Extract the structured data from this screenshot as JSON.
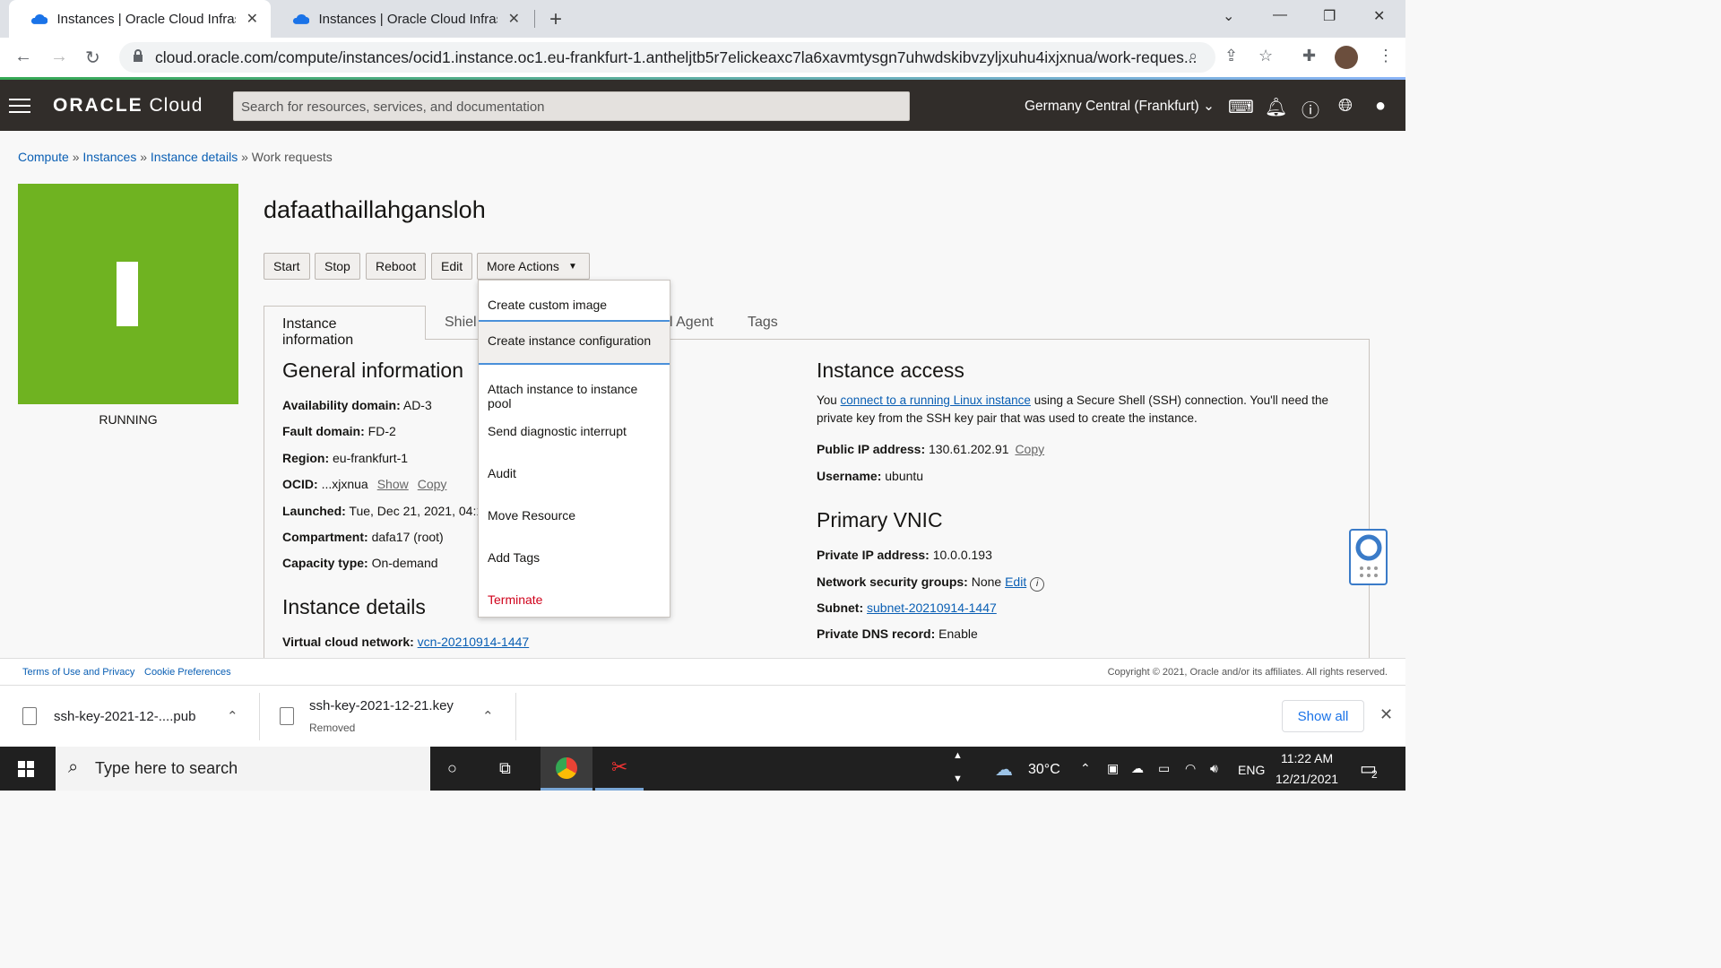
{
  "browser": {
    "tabs": [
      {
        "title": "Instances | Oracle Cloud Infrastructure"
      },
      {
        "title": "Instances | Oracle Cloud Infrastructure"
      }
    ],
    "url": "cloud.oracle.com/compute/instances/ocid1.instance.oc1.eu-frankfurt-1.antheljtb5r7elickeaxc7la6xavmtysgn7uhwdskibvzyljxuhu4ixjxnua/work-reques..."
  },
  "header": {
    "logo_a": "ORACLE",
    "logo_b": "Cloud",
    "search_placeholder": "Search for resources, services, and documentation",
    "region": "Germany Central (Frankfurt)"
  },
  "breadcrumb": {
    "items": [
      "Compute",
      "Instances",
      "Instance details"
    ],
    "sep": "»",
    "current": "Work requests"
  },
  "instance": {
    "name": "dafaathaillahgansloh",
    "status": "RUNNING",
    "status_color": "#6fb321",
    "actions": [
      "Start",
      "Stop",
      "Reboot",
      "Edit",
      "More Actions"
    ]
  },
  "tabs": [
    "Instance information",
    "Shiel",
    "l Agent",
    "Tags"
  ],
  "more_actions_menu": [
    "Create custom image",
    "Create instance configuration",
    "Attach instance to instance pool",
    "Send diagnostic interrupt",
    "Audit",
    "Move Resource",
    "Add Tags",
    "Terminate"
  ],
  "general": {
    "heading": "General information",
    "rows": [
      {
        "k": "Availability domain:",
        "v": "AD-3"
      },
      {
        "k": "Fault domain:",
        "v": "FD-2"
      },
      {
        "k": "Region:",
        "v": "eu-frankfurt-1"
      },
      {
        "k": "OCID:",
        "v": "...xjxnua"
      },
      {
        "k": "Launched:",
        "v": "Tue, Dec 21, 2021, 04:1"
      },
      {
        "k": "Compartment:",
        "v": "dafa17 (root)"
      },
      {
        "k": "Capacity type:",
        "v": "On-demand"
      }
    ],
    "show": "Show",
    "copy": "Copy"
  },
  "details": {
    "heading": "Instance details",
    "vcn_label": "Virtual cloud network:",
    "vcn": "vcn-20210914-1447"
  },
  "access": {
    "heading": "Instance access",
    "text_a": "You",
    "link": "connect to a running Linux instance",
    "text_b": "using a Secure Shell (SSH) connection. You'll need the",
    "text_c": "private key from the SSH key pair that was used to create the instance.",
    "ip_label": "Public IP address:",
    "ip": "130.61.202.91",
    "copy": "Copy",
    "user_label": "Username:",
    "user": "ubuntu"
  },
  "vnic": {
    "heading": "Primary VNIC",
    "priv_label": "Private IP address:",
    "priv": "10.0.0.193",
    "nsg_label": "Network security groups:",
    "nsg": "None",
    "edit": "Edit",
    "subnet_label": "Subnet:",
    "subnet": "subnet-20210914-1447",
    "dns_label": "Private DNS record:",
    "dns": "Enable"
  },
  "footer": {
    "terms": "Terms of Use and Privacy",
    "cookies": "Cookie Preferences",
    "copyright": "Copyright © 2021, Oracle and/or its affiliates. All rights reserved."
  },
  "downloads": {
    "file1": "ssh-key-2021-12-....pub",
    "file2": "ssh-key-2021-12-21.key",
    "file2_status": "Removed",
    "show_all": "Show all"
  },
  "taskbar": {
    "search": "Type here to search",
    "temp": "30°C",
    "lang": "ENG",
    "time": "11:22 AM",
    "date": "12/21/2021",
    "notif": "2"
  }
}
